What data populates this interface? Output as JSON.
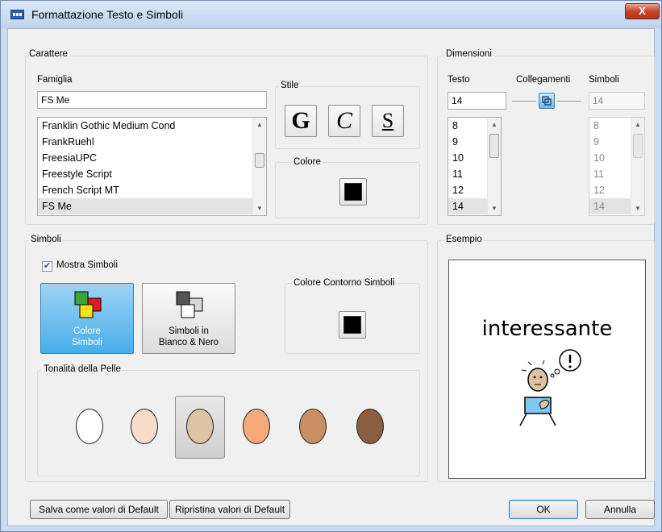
{
  "window": {
    "title": "Formattazione Testo e Simboli",
    "close_glyph": "X"
  },
  "carattere": {
    "group_label": "Carattere",
    "famiglia_label": "Famiglia",
    "font_value": "FS Me",
    "fonts": [
      "Franklin Gothic Medium Cond",
      "FrankRuehl",
      "FreesiaUPC",
      "Freestyle Script",
      "French Script MT",
      "FS Me"
    ],
    "stile_label": "Stile",
    "style_buttons": {
      "bold": "G",
      "italic": "C",
      "underline": "S"
    },
    "colore_label": "Colore",
    "text_color": "#000000"
  },
  "dimensioni": {
    "group_label": "Dimensioni",
    "testo_label": "Testo",
    "collegamenti_label": "Collegamenti",
    "simboli_label": "Simboli",
    "testo_value": "14",
    "simboli_value": "14",
    "sizes": [
      "8",
      "9",
      "10",
      "11",
      "12",
      "14"
    ]
  },
  "simboli": {
    "group_label": "Simboli",
    "mostra_simboli_label": "Mostra Simboli",
    "mostra_simboli_checked": true,
    "colore_simboli_label": [
      "Colore",
      "Simboli"
    ],
    "bianco_nero_label": [
      "Simboli in",
      "Bianco & Nero"
    ],
    "contorno_label": "Colore Contorno Simboli",
    "outline_color": "#000000",
    "tonalita_label": "Tonalità della Pelle",
    "skin_tones": [
      "#ffffff",
      "#f5dccb",
      "#dcc3a2",
      "#f6a87a",
      "#c98e64",
      "#8b5e3f"
    ],
    "selected_skin_index": 2
  },
  "esempio": {
    "group_label": "Esempio",
    "word": "interessante"
  },
  "buttons": {
    "salva": "Salva come valori di Default",
    "ripristina": "Ripristina valori di Default",
    "ok": "OK",
    "annulla": "Annulla"
  },
  "accent_color": "#46aeea"
}
